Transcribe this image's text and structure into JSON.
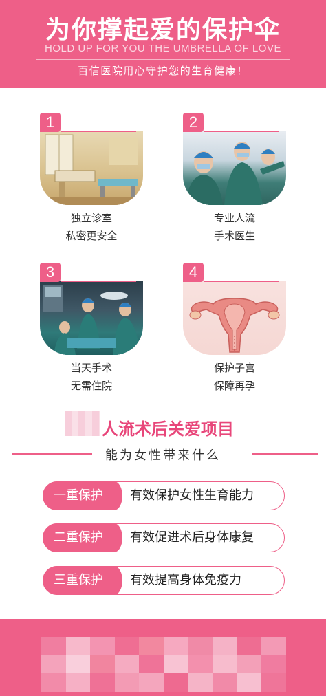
{
  "header": {
    "title": "为你撑起爱的保护伞",
    "subtitle_en": "HOLD UP FOR YOU THE UMBRELLA OF LOVE",
    "tagline": "百信医院用心守护您的生育健康！"
  },
  "features": [
    {
      "num": "1",
      "line1": "独立诊室",
      "line2": "私密更安全"
    },
    {
      "num": "2",
      "line1": "专业人流",
      "line2": "手术医生"
    },
    {
      "num": "3",
      "line1": "当天手术",
      "line2": "无需住院"
    },
    {
      "num": "4",
      "line1": "保护子宫",
      "line2": "保障再孕"
    }
  ],
  "section": {
    "title": "人流术后关爱项目",
    "subtitle": "能为女性带来什么"
  },
  "protections": [
    {
      "tag": "一重保护",
      "desc": "有效保护女性生育能力"
    },
    {
      "tag": "二重保护",
      "desc": "有效促进术后身体康复"
    },
    {
      "tag": "三重保护",
      "desc": "有效提高身体免疫力"
    }
  ],
  "colors": {
    "brand_pink": "#ee5f88",
    "title_pink": "#e8467a"
  }
}
